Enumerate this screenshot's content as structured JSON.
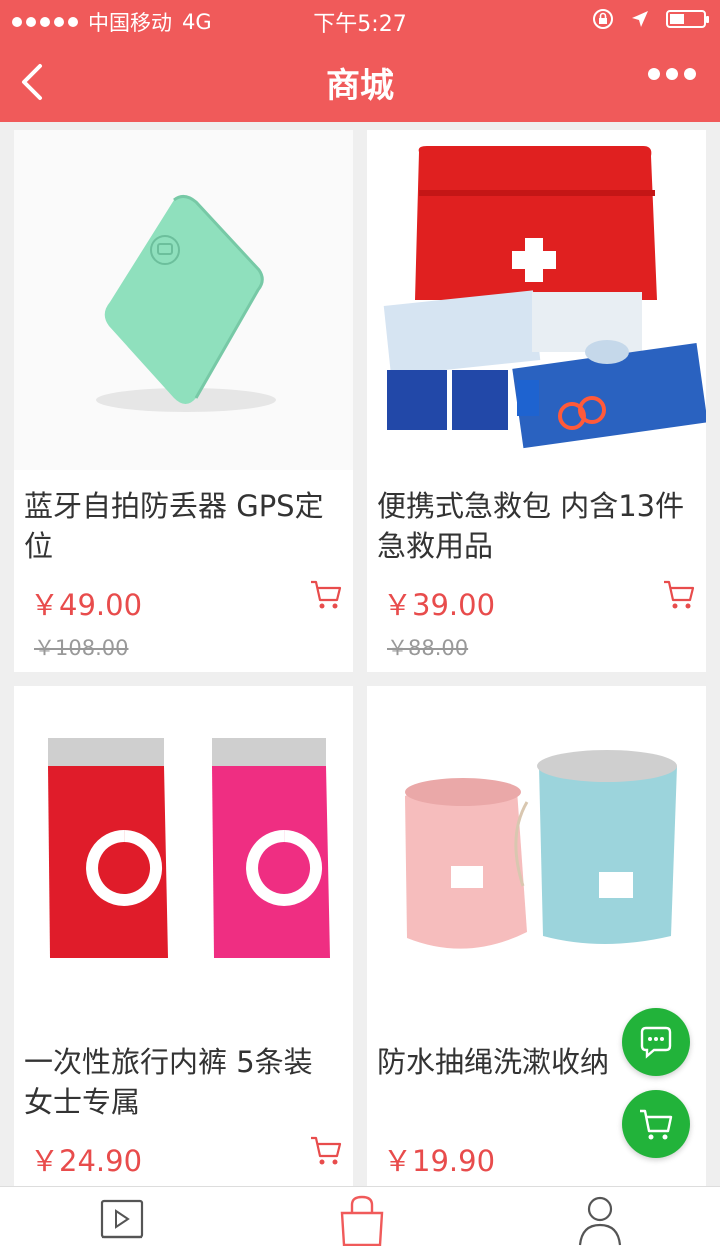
{
  "status_bar": {
    "carrier": "中国移动",
    "network": "4G",
    "time": "下午5:27",
    "battery_level": 0.45
  },
  "nav": {
    "title": "商城",
    "back_icon": "chevron-left-icon",
    "more_icon": "more-icon"
  },
  "products": [
    {
      "name": "蓝牙自拍防丢器 GPS定位",
      "price": "￥49.00",
      "original_price": "￥108.00"
    },
    {
      "name": "便携式急救包 内含13件急救用品",
      "price": "￥39.00",
      "original_price": "￥88.00"
    },
    {
      "name": "一次性旅行内裤 5条装 女士专属",
      "price": "￥24.90",
      "original_price": ""
    },
    {
      "name": "防水抽绳洗漱收纳",
      "price": "￥19.90",
      "original_price": ""
    }
  ],
  "floating": {
    "chat_icon": "chat-bubble-icon",
    "cart_icon": "cart-icon"
  },
  "tabbar": {
    "items": [
      {
        "icon": "video-icon"
      },
      {
        "icon": "shopping-bag-icon",
        "active": true
      },
      {
        "icon": "user-icon"
      }
    ]
  },
  "colors": {
    "primary": "#f05a5a",
    "price": "#e84c4c",
    "fab": "#22b33a"
  }
}
